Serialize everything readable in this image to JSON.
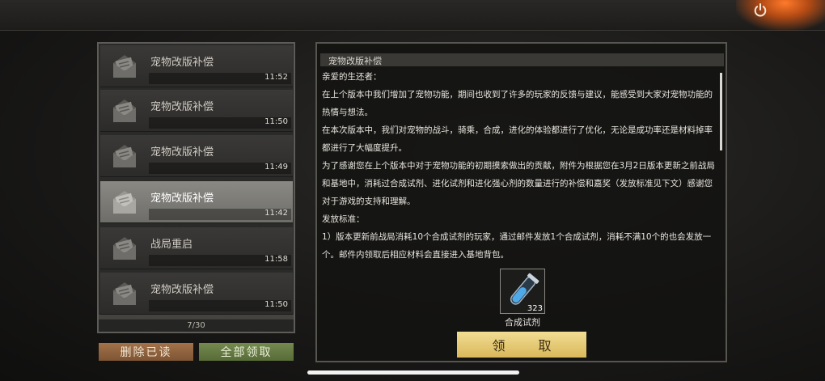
{
  "mail_list": {
    "items": [
      {
        "title": "宠物改版补偿",
        "time": "11:52",
        "selected": false
      },
      {
        "title": "宠物改版补偿",
        "time": "11:50",
        "selected": false
      },
      {
        "title": "宠物改版补偿",
        "time": "11:49",
        "selected": false
      },
      {
        "title": "宠物改版补偿",
        "time": "11:42",
        "selected": true
      },
      {
        "title": "战局重启",
        "time": "11:58",
        "selected": false
      },
      {
        "title": "宠物改版补偿",
        "time": "11:50",
        "selected": false
      }
    ],
    "pager": "7/30"
  },
  "buttons": {
    "delete_read": "删除已读",
    "claim_all": "全部领取",
    "claim": "领 取"
  },
  "mail_content": {
    "header": "宠物改版补偿",
    "paragraphs": [
      "亲爱的生还者：",
      "在上个版本中我们增加了宠物功能，期间也收到了许多的玩家的反馈与建议，能感受到大家对宠物功能的热情与想法。",
      "在本次版本中，我们对宠物的战斗，骑乘，合成，进化的体验都进行了优化，无论是成功率还是材料掉率都进行了大幅度提升。",
      "为了感谢您在上个版本中对于宠物功能的初期摸索做出的贡献，附件为根据您在3月2日版本更新之前战局和基地中，消耗过合成试剂、进化试剂和进化强心剂的数量进行的补偿和嘉奖（发放标准见下文）感谢您对于游戏的支持和理解。",
      "发放标准：",
      "1）版本更新前战局消耗10个合成试剂的玩家，通过邮件发放1个合成试剂，消耗不满10个的也会发放一个。邮件内领取后相应材料会直接进入基地背包。"
    ],
    "attachment": {
      "name": "合成试剂",
      "count": "323",
      "icon": "test-tube-icon"
    }
  },
  "colors": {
    "claim_button": "#e4c66f",
    "delete_button": "#8e6040",
    "claim_all_button": "#66793f"
  }
}
